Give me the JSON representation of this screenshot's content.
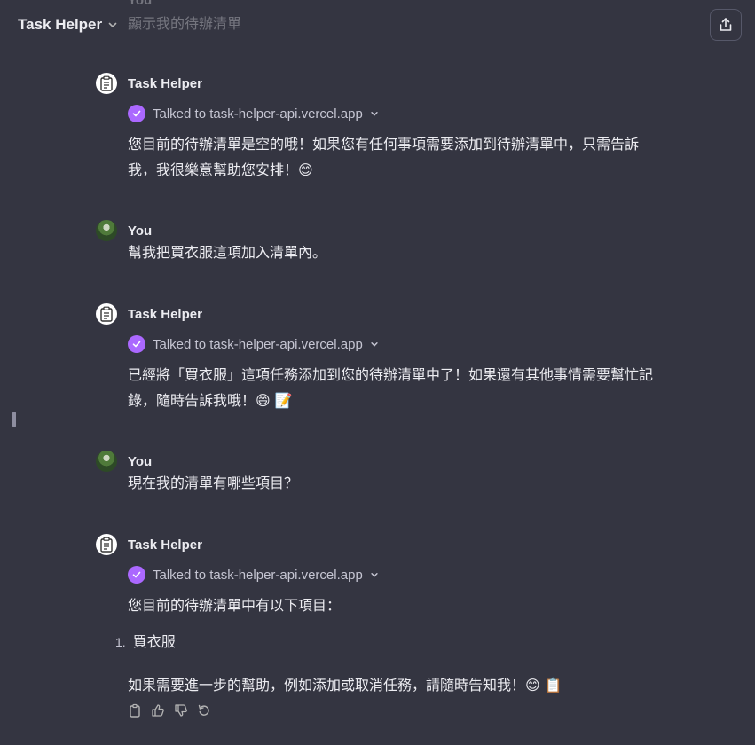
{
  "header": {
    "app_title": "Task Helper",
    "chevron": "chevron-down-icon"
  },
  "faded_previous": {
    "sender": "You",
    "text": "顯示我的待辦清單"
  },
  "share_icon": "share-icon",
  "messages": [
    {
      "sender": "Task Helper",
      "tool_call": "Talked to task-helper-api.vercel.app",
      "text": "您目前的待辦清單是空的哦！如果您有任何事項需要添加到待辦清單中，只需告訴",
      "text2": "我，我很樂意幫助您安排！😊"
    },
    {
      "sender": "You",
      "text": "幫我把買衣服這項加入清單內。"
    },
    {
      "sender": "Task Helper",
      "tool_call": "Talked to task-helper-api.vercel.app",
      "text": "已經將「買衣服」這項任務添加到您的待辦清單中了！如果還有其他事情需要幫忙記",
      "text2": "錄，隨時告訴我哦！😄 📝"
    },
    {
      "sender": "You",
      "text": "現在我的清單有哪些項目？"
    },
    {
      "sender": "Task Helper",
      "tool_call": "Talked to task-helper-api.vercel.app",
      "text": "您目前的待辦清單中有以下項目：",
      "list": [
        {
          "num": "1.",
          "item": "買衣服"
        }
      ],
      "text2": "如果需要進一步的幫助，例如添加或取消任務，請隨時告知我！😊 📋"
    }
  ],
  "colors": {
    "background": "#343541",
    "accent": "#ab68ff",
    "text": "#ececf1"
  }
}
